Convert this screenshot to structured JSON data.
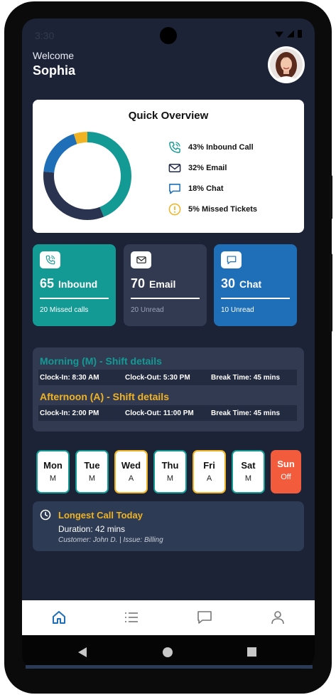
{
  "status": {
    "time": "3:30"
  },
  "user": {
    "greeting": "Welcome",
    "name": "Sophia"
  },
  "overview": {
    "title": "Quick Overview",
    "legend": [
      {
        "text": "43% Inbound Call",
        "icon": "phone-icon",
        "color": "#139a94"
      },
      {
        "text": "32% Email",
        "icon": "mail-icon",
        "color": "#222a44"
      },
      {
        "text": "18% Chat",
        "icon": "chat-icon",
        "color": "#1f6fb8"
      },
      {
        "text": "5% Missed Tickets",
        "icon": "alert-icon",
        "color": "#f0b323"
      }
    ],
    "chart_data": {
      "type": "pie",
      "categories": [
        "Inbound Call",
        "Email",
        "Chat",
        "Missed Tickets"
      ],
      "values": [
        43,
        32,
        18,
        5
      ],
      "colors": [
        "#139a94",
        "#2a3350",
        "#1f6fb8",
        "#f0b323"
      ]
    }
  },
  "stats": [
    {
      "number": "65",
      "label": "Inbound",
      "sub": "20 Missed calls",
      "icon": "phone-icon",
      "bg": "#139a94",
      "sub_color": "#ffffff"
    },
    {
      "number": "70",
      "label": "Email",
      "sub": "20 Unread",
      "icon": "mail-icon",
      "bg": "#323a52",
      "sub_color": "#9aa1b3"
    },
    {
      "number": "30",
      "label": "Chat",
      "sub": "10 Unread",
      "icon": "chat-icon",
      "bg": "#1f6fb8",
      "sub_color": "#ffffff"
    }
  ],
  "shifts": [
    {
      "title": "Morning (M) - Shift details",
      "color": "#139a94",
      "clock_in": "Clock-In: 8:30 AM",
      "clock_out": "Clock-Out: 5:30 PM",
      "break": "Break Time: 45 mins"
    },
    {
      "title": "Afternoon (A) - Shift details",
      "color": "#f0b323",
      "clock_in": "Clock-In: 2:00 PM",
      "clock_out": "Clock-Out: 11:00 PM",
      "break": "Break Time: 45 mins"
    }
  ],
  "days": [
    {
      "name": "Mon",
      "code": "M"
    },
    {
      "name": "Tue",
      "code": "M"
    },
    {
      "name": "Wed",
      "code": "A"
    },
    {
      "name": "Thu",
      "code": "M"
    },
    {
      "name": "Fri",
      "code": "A"
    },
    {
      "name": "Sat",
      "code": "M"
    },
    {
      "name": "Sun",
      "code": "Off"
    }
  ],
  "longest_call": {
    "title": "Longest Call Today",
    "duration": "Duration: 42 mins",
    "meta": "Customer: John D. | Issue: Billing"
  },
  "tabs": [
    "home-icon",
    "list-icon",
    "chat-icon",
    "profile-icon"
  ]
}
